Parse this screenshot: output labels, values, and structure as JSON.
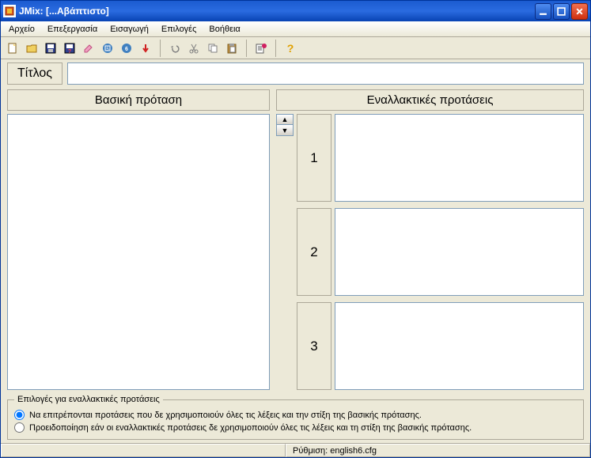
{
  "window": {
    "title": "JMix: [...Αβάπτιστο]"
  },
  "menu": [
    "Αρχείο",
    "Επεξεργασία",
    "Εισαγωγή",
    "Επιλογές",
    "Βοήθεια"
  ],
  "toolbar_icons": [
    "new-icon",
    "open-icon",
    "save-icon",
    "save-as-icon",
    "clear-icon",
    "export-v5-icon",
    "export-v6-icon",
    "arrow-down-icon",
    "sep",
    "undo-icon",
    "cut-icon",
    "copy-icon",
    "paste-icon",
    "sep",
    "add-text-icon",
    "sep",
    "help-icon"
  ],
  "title_section": {
    "label": "Τίτλος",
    "value": ""
  },
  "main_sentence": {
    "header": "Βασική πρόταση",
    "value": ""
  },
  "alternates": {
    "header": "Εναλλακτικές προτάσεις",
    "rows": [
      {
        "num": "1",
        "value": ""
      },
      {
        "num": "2",
        "value": ""
      },
      {
        "num": "3",
        "value": ""
      }
    ]
  },
  "options": {
    "legend": "Επιλογές για εναλλακτικές προτάσεις",
    "opt1": "Να επιτρέπονται προτάσεις που δε χρησιμοποιούν όλες τις λέξεις και την στίξη της βασικής πρότασης.",
    "opt2": "Προειδοποίηση εάν οι εναλλακτικές προτάσεις δε χρησιμοποιούν όλες τις λέξεις και τη στίξη της βασικής πρότασης.",
    "selected": 0
  },
  "statusbar": {
    "config": "Ρύθμιση: english6.cfg"
  }
}
